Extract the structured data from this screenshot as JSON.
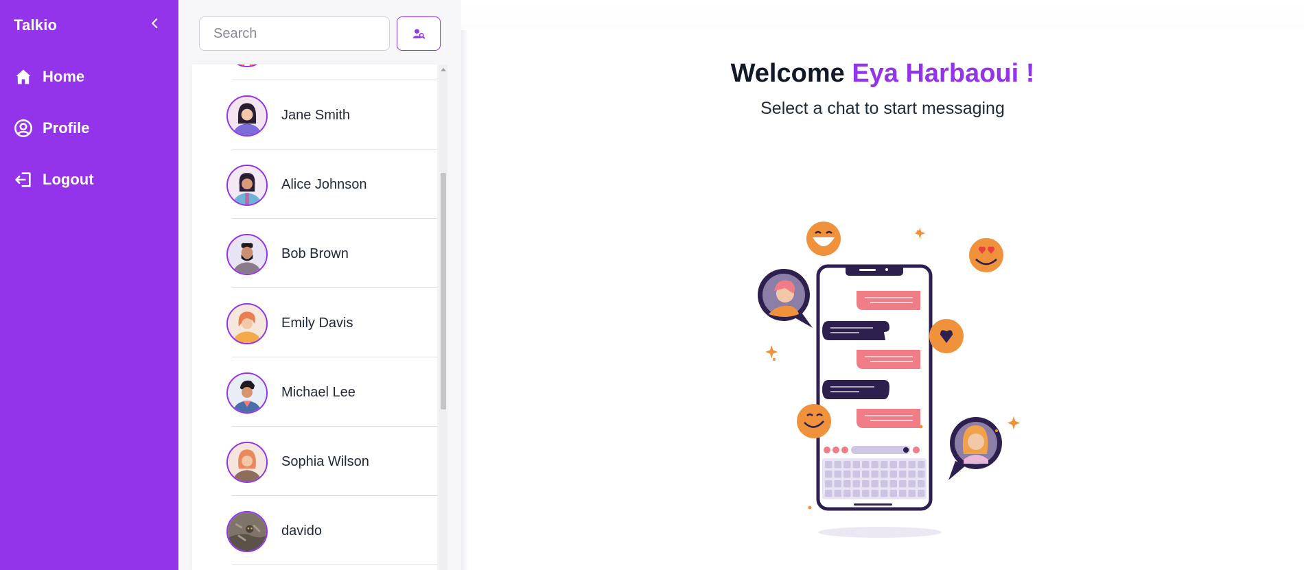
{
  "app": {
    "name": "Talkio"
  },
  "nav": {
    "items": [
      {
        "label": "Home",
        "icon": "home-icon"
      },
      {
        "label": "Profile",
        "icon": "user-circle-icon"
      },
      {
        "label": "Logout",
        "icon": "logout-icon"
      }
    ]
  },
  "search": {
    "placeholder": "Search",
    "value": ""
  },
  "contacts": [
    {
      "name": "Jane Smith"
    },
    {
      "name": "Alice Johnson"
    },
    {
      "name": "Bob Brown"
    },
    {
      "name": "Emily Davis"
    },
    {
      "name": "Michael Lee"
    },
    {
      "name": "Sophia Wilson"
    },
    {
      "name": "davido"
    }
  ],
  "welcome": {
    "prefix": "Welcome ",
    "user": "Eya Harbaoui !",
    "subtitle": "Select a chat to start messaging"
  },
  "colors": {
    "accent": "#9333ea",
    "pink": "#f07c86",
    "dark": "#2d1f4e",
    "orange": "#f0923c"
  }
}
